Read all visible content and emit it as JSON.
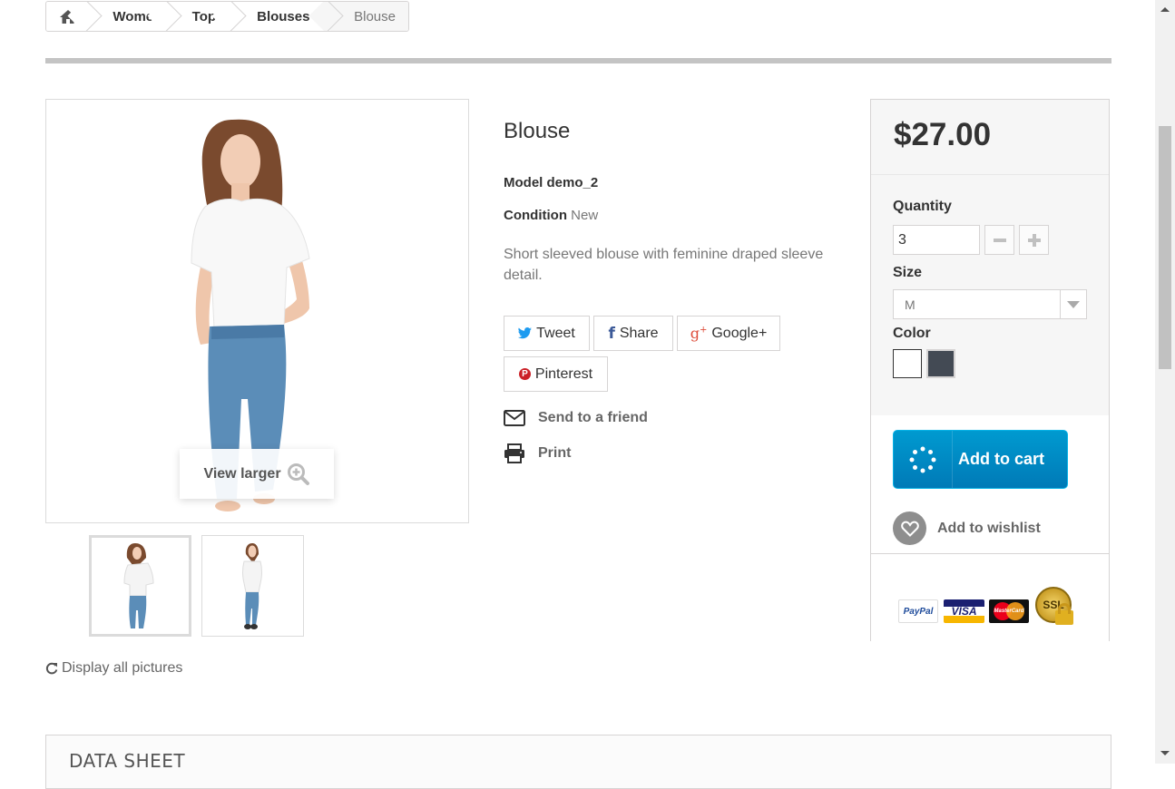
{
  "breadcrumb": {
    "home_icon": "home-icon",
    "items": [
      "Women",
      "Tops",
      "Blouses",
      "Blouse"
    ]
  },
  "gallery": {
    "view_larger": "View larger",
    "display_all": "Display all pictures"
  },
  "product": {
    "title": "Blouse",
    "model_label": "Model",
    "model_value": "demo_2",
    "condition_label": "Condition",
    "condition_value": "New",
    "description": "Short sleeved blouse with feminine draped sleeve detail."
  },
  "social": {
    "tweet": "Tweet",
    "share": "Share",
    "google": "Google+",
    "pinterest": "Pinterest"
  },
  "links": {
    "send_to_friend": "Send to a friend",
    "print": "Print"
  },
  "buybox": {
    "price": "$27.00",
    "quantity_label": "Quantity",
    "quantity_value": "3",
    "size_label": "Size",
    "size_value": "M",
    "color_label": "Color",
    "colors": [
      "#ffffff",
      "#434a54"
    ],
    "add_to_cart": "Add to cart",
    "add_to_wishlist": "Add to wishlist",
    "payment": [
      "PayPal",
      "VISA",
      "MasterCard",
      "SSL"
    ]
  },
  "datasheet": {
    "title": "DATA SHEET"
  },
  "colors": {
    "accent_blue": "#009ad0",
    "border": "#d6d4d4"
  }
}
